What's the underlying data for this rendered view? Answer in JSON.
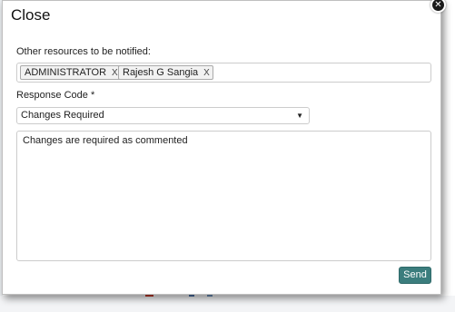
{
  "dialog": {
    "title": "Close",
    "close_label": "✕"
  },
  "notify": {
    "label": "Other resources to be notified:",
    "tags": [
      {
        "label": "ADMINISTRATOR",
        "remove_label": "X"
      },
      {
        "label": "Rajesh G Sangia",
        "remove_label": "X"
      }
    ]
  },
  "response_code": {
    "label": "Response Code *",
    "selected": "Changes Required",
    "arrow": "▼"
  },
  "comment": {
    "value": "Changes are required as commented"
  },
  "actions": {
    "send_label": "Send"
  },
  "colors": {
    "send_button": "#3b7d7d",
    "close_button": "#1a1a1a"
  }
}
